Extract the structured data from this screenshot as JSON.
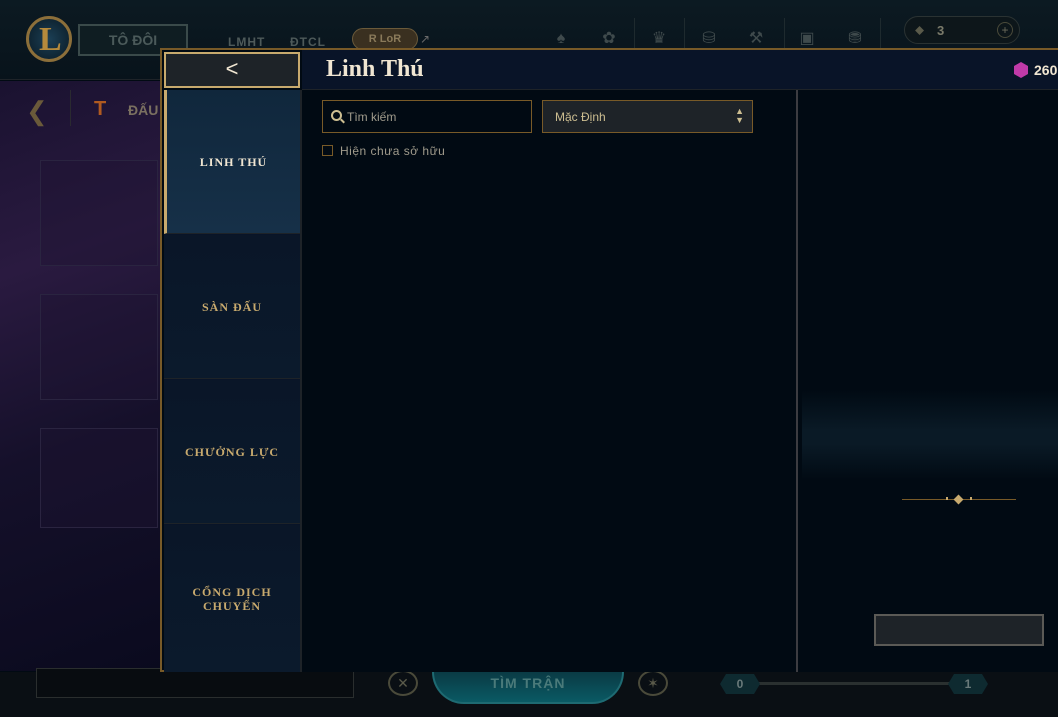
{
  "client": {
    "play_button_label": "TÔ ĐÔI",
    "nav_links": [
      "LMHT",
      "ĐTCL"
    ],
    "lor_label": "LoR",
    "external_arrow": "↗",
    "currency_count": "3",
    "mode_title": "ĐẤU",
    "find_match_label": "TÌM TRẬN",
    "progress_start": "0",
    "progress_end": "1"
  },
  "modal": {
    "title": "Linh Thú",
    "back_glyph": "<",
    "currency_value": "260",
    "nav_items": [
      {
        "label": "LINH THÚ",
        "active": true
      },
      {
        "label": "SÀN ĐẤU",
        "active": false
      },
      {
        "label": "CHƯỞNG LỰC",
        "active": false
      },
      {
        "label": "CỔNG DỊCH CHUYỂN",
        "active": false
      }
    ],
    "search": {
      "placeholder": "Tìm kiếm",
      "value": ""
    },
    "sort": {
      "selected": "Mặc Định"
    },
    "show_unowned": {
      "label": "Hiện chưa sở hữu",
      "checked": false
    },
    "action_button": {
      "label": ""
    }
  }
}
